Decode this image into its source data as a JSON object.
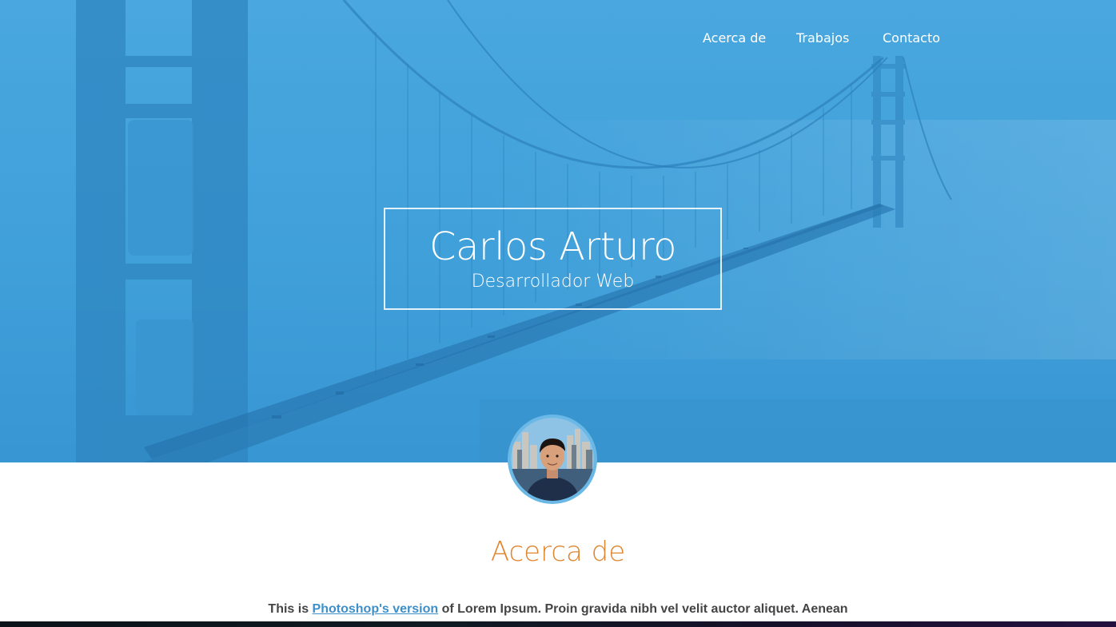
{
  "colors": {
    "hero_blue": "#3d9ed9",
    "accent_orange": "#e0852f",
    "link_blue": "#3d8fc9",
    "text_gray": "#444444"
  },
  "nav": {
    "items": [
      {
        "label": "Acerca de"
      },
      {
        "label": "Trabajos"
      },
      {
        "label": "Contacto"
      }
    ]
  },
  "hero": {
    "name": "Carlos Arturo",
    "role": "Desarrollador Web",
    "background": "golden-gate-bridge-photo"
  },
  "avatar": {
    "icon": "profile-photo"
  },
  "about": {
    "title": "Acerca de",
    "text_before": "This is ",
    "link_text": "Photoshop's version",
    "text_after": " of Lorem Ipsum. Proin gravida nibh vel velit auctor aliquet. Aenean"
  }
}
